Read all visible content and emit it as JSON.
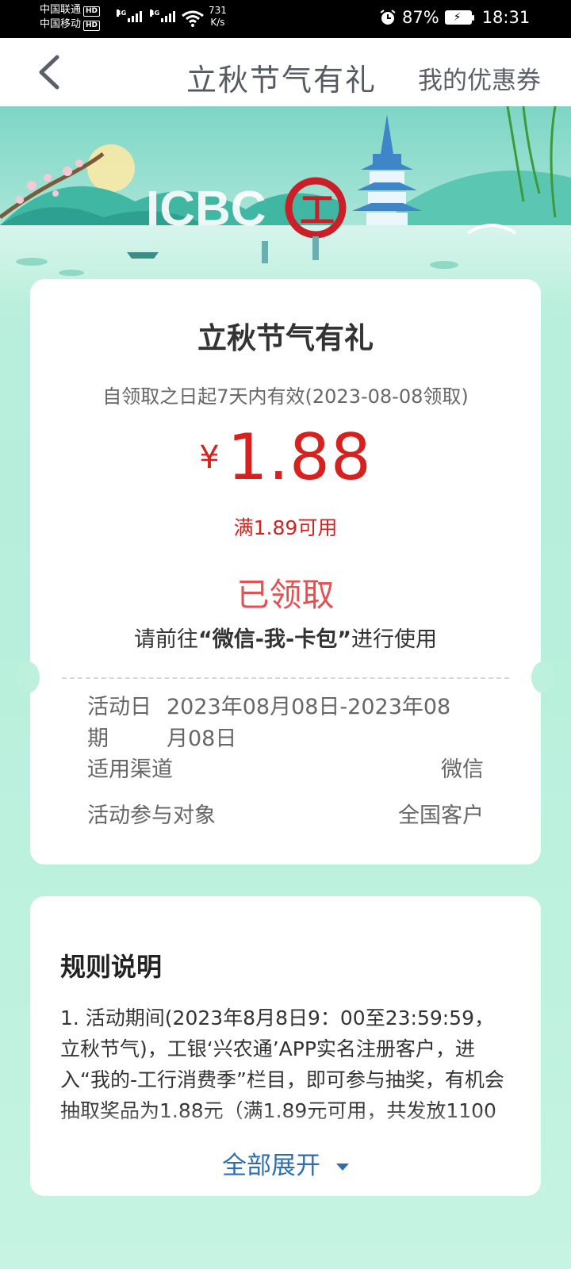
{
  "status_bar": {
    "carrier_1": "中国联通",
    "carrier_2": "中国移动",
    "hd_label": "HD",
    "network_label": "4G",
    "net_speed_value": "731",
    "net_speed_unit": "K/s",
    "battery": "87%",
    "time": "18:31"
  },
  "nav": {
    "title": "立秋节气有礼",
    "right_link": "我的优惠券",
    "back_icon": "chevron-left-icon"
  },
  "banner": {
    "logo_text": "ICBC",
    "logo_mark": "工"
  },
  "coupon": {
    "title": "立秋节气有礼",
    "validity": "自领取之日起7天内有效(2023-08-08领取)",
    "currency": "¥",
    "amount": "1.88",
    "min_spend": "满1.89可用",
    "status": "已领取",
    "hint_prefix": "请前往",
    "hint_highlight": "“微信-我-卡包”",
    "hint_suffix": "进行使用",
    "details": [
      {
        "label": "活动日期",
        "value": "2023年08月08日-2023年08月08日"
      },
      {
        "label": "适用渠道",
        "value": "微信"
      },
      {
        "label": "活动参与对象",
        "value": "全国客户"
      }
    ]
  },
  "rules": {
    "title": "规则说明",
    "body": "1. 活动期间(2023年8月8日9：00至23:59:59，立秋节气)，工银‘兴农通’APP实名注册客户，进入“我的-工行消费季”栏目，即可参与抽奖，有机会抽取奖品为1.88元（满1.89元可用，共发放1100",
    "expand_label": "全部展开"
  },
  "colors": {
    "accent_red": "#d6211f",
    "status_red": "#e45153",
    "link_blue": "#2f6db1",
    "page_green": "#bdf0dd"
  }
}
